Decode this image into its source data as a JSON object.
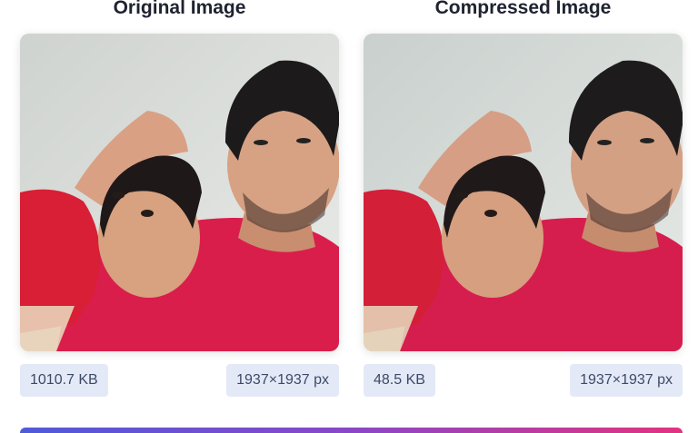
{
  "original": {
    "title": "Original Image",
    "file_size": "1010.7 KB",
    "dimensions": "1937×1937 px"
  },
  "compressed": {
    "title": "Compressed Image",
    "file_size": "48.5 KB",
    "dimensions": "1937×1937 px"
  },
  "colors": {
    "chip_background": "#e4e9f8",
    "chip_text": "#3d4a66",
    "title_text": "#1f2330",
    "bar_gradient_start": "#4f5ad9",
    "bar_gradient_end": "#e2337f"
  }
}
